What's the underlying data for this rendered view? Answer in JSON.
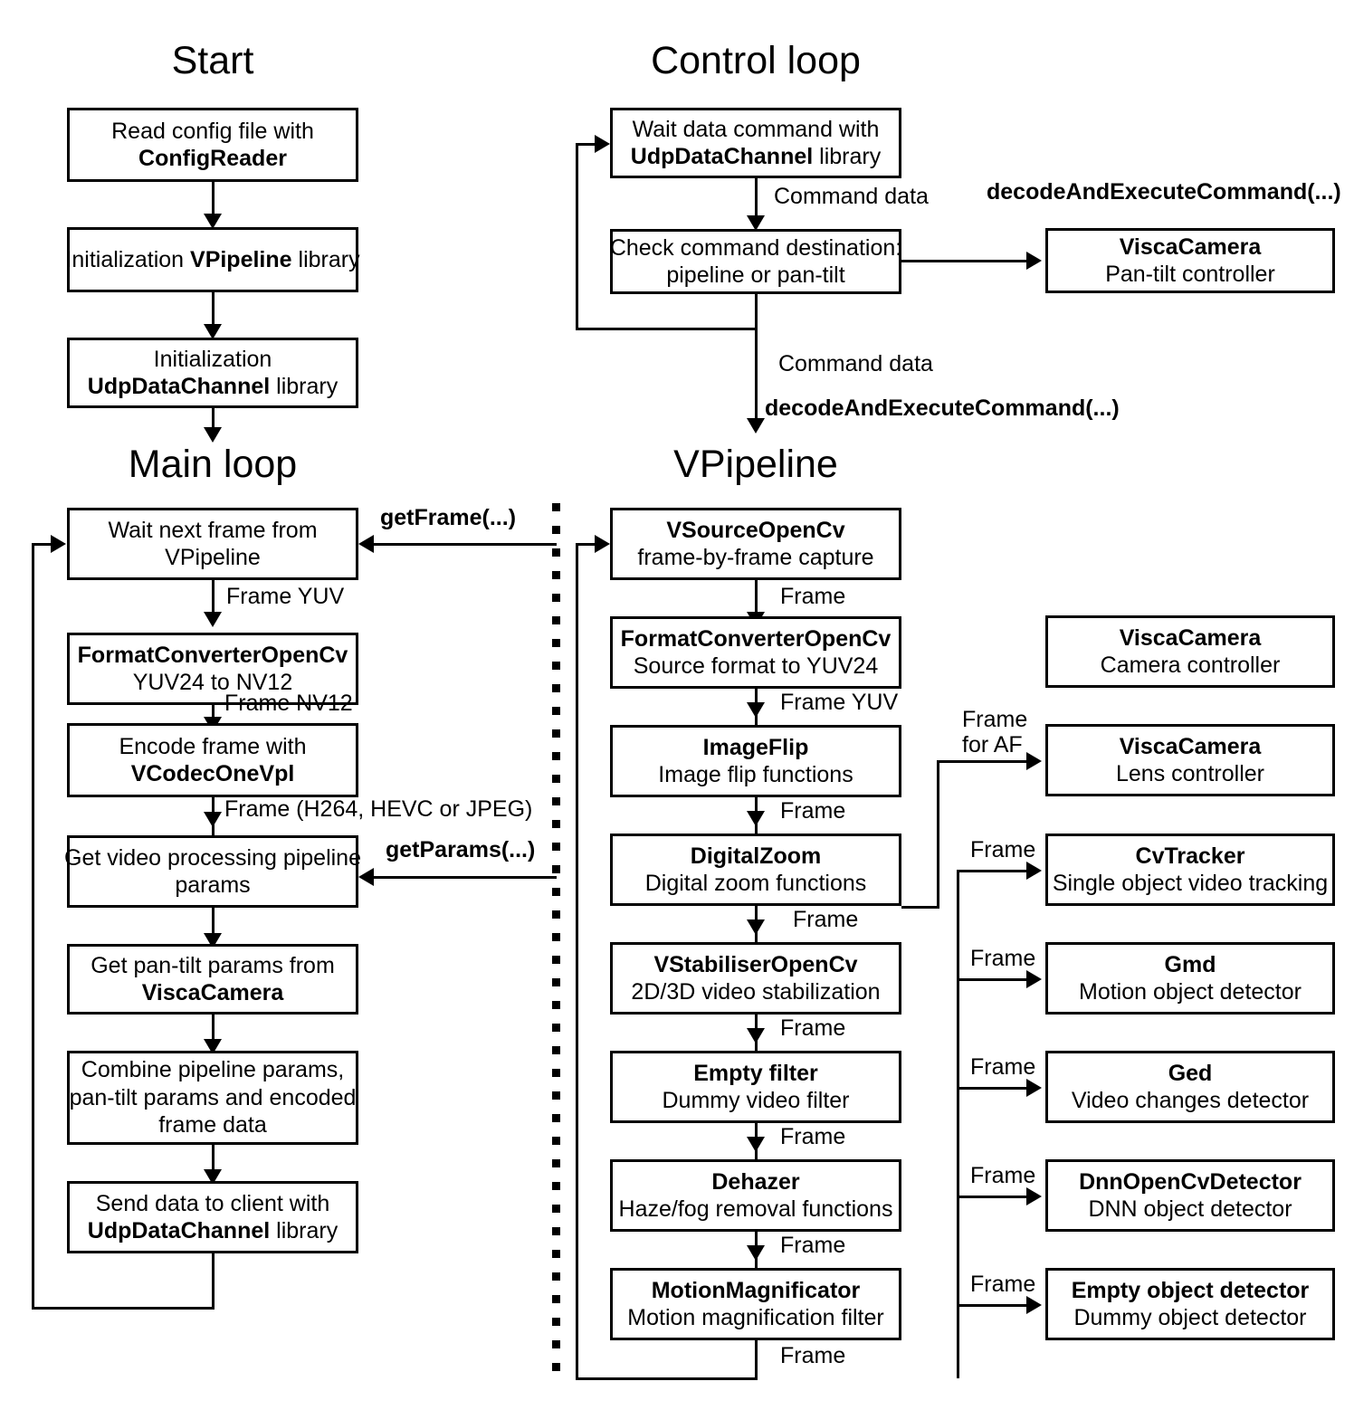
{
  "sections": {
    "start": "Start",
    "control_loop": "Control loop",
    "main_loop": "Main loop",
    "vpipeline": "VPipeline"
  },
  "start_nodes": [
    {
      "line1": "Read config file with",
      "line2": "ConfigReader",
      "bold1": false,
      "bold2": true
    },
    {
      "line1": "Initialization VPipeline library",
      "bold_word": "VPipeline"
    },
    {
      "line1": "Initialization",
      "line2": "UdpDataChannel library",
      "bold1": false,
      "bold2": "partial"
    }
  ],
  "control_nodes": [
    {
      "line1": "Wait data command with",
      "line2": "UdpDataChannel library"
    },
    {
      "line1": "Check command destination:",
      "line2": "pipeline or pan-tilt"
    },
    {
      "line1": "ViscaCamera",
      "line2": "Pan-tilt controller"
    }
  ],
  "control_labels": {
    "command_data_1": "Command data",
    "command_data_2": "Command data",
    "decode_right": "decodeAndExecuteCommand(...)",
    "decode_down": "decodeAndExecuteCommand(...)"
  },
  "main_nodes": [
    {
      "line1": "Wait next frame from",
      "line2": "VPipeline"
    },
    {
      "line1": "FormatConverterOpenCv",
      "line2": "YUV24 to NV12"
    },
    {
      "line1": "Encode frame with",
      "line2": "VCodecOneVpl"
    },
    {
      "line1": "Get video processing pipeline",
      "line2": "params"
    },
    {
      "line1": "Get pan-tilt params from",
      "line2": "ViscaCamera"
    },
    {
      "line1": "Combine pipeline params,",
      "line2": "pan-tilt params and encoded",
      "line3": "frame data"
    },
    {
      "line1": "Send data to client with",
      "line2": "UdpDataChannel library"
    }
  ],
  "main_labels": {
    "frame_yuv": "Frame YUV",
    "frame_nv12": "Frame NV12",
    "frame_codec": "Frame (H264, HEVC or JPEG)",
    "get_frame": "getFrame(...)",
    "get_params": "getParams(...)"
  },
  "pipeline_nodes": [
    {
      "title": "VSourceOpenCv",
      "subtitle": "frame-by-frame capture"
    },
    {
      "title": "FormatConverterOpenCv",
      "subtitle": "Source format to YUV24"
    },
    {
      "title": "ImageFlip",
      "subtitle": "Image flip functions"
    },
    {
      "title": "DigitalZoom",
      "subtitle": "Digital zoom functions"
    },
    {
      "title": "VStabiliserOpenCv",
      "subtitle": "2D/3D video stabilization"
    },
    {
      "title": "Empty filter",
      "subtitle": "Dummy video filter"
    },
    {
      "title": "Dehazer",
      "subtitle": "Haze/fog removal functions"
    },
    {
      "title": "MotionMagnificator",
      "subtitle": "Motion magnification filter"
    }
  ],
  "pipeline_labels": {
    "e1": "Frame",
    "e2": "Frame YUV",
    "e3": "Frame",
    "e4": "Frame",
    "e5": "Frame",
    "e6": "Frame",
    "e7": "Frame",
    "e8": "Frame"
  },
  "right_nodes": [
    {
      "title": "ViscaCamera",
      "subtitle": "Camera controller"
    },
    {
      "title": "ViscaCamera",
      "subtitle": "Lens controller"
    },
    {
      "title": "CvTracker",
      "subtitle": "Single object video tracking"
    },
    {
      "title": "Gmd",
      "subtitle": "Motion object detector"
    },
    {
      "title": "Ged",
      "subtitle": "Video changes detector"
    },
    {
      "title": "DnnOpenCvDetector",
      "subtitle": "DNN object detector"
    },
    {
      "title": "Empty object detector",
      "subtitle": "Dummy object detector"
    }
  ],
  "right_labels": {
    "af_line1": "Frame",
    "af_line2": "for AF",
    "tracker": "Frame",
    "gmd": "Frame",
    "ged": "Frame",
    "dnn": "Frame",
    "empty": "Frame"
  },
  "colors": {
    "stroke": "#000000",
    "background": "#ffffff"
  }
}
